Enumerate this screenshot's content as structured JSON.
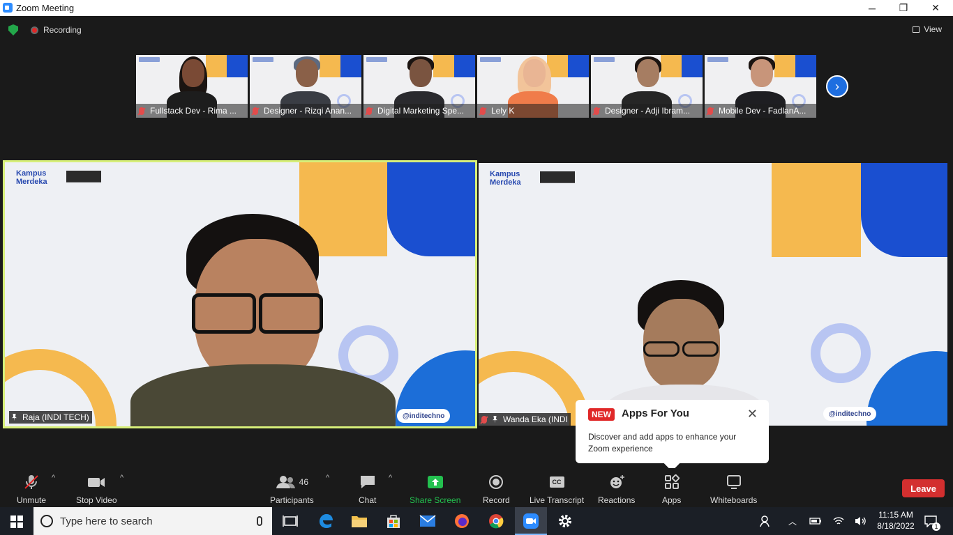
{
  "window": {
    "title": "Zoom Meeting",
    "minimize": "─",
    "restore": "❐",
    "close": "✕"
  },
  "topbar": {
    "recording_label": "Recording",
    "view_label": "View"
  },
  "thumbnails": [
    {
      "name": "Fullstack Dev - Rima ...",
      "skin": "#7a4a35"
    },
    {
      "name": "Designer - Rizqi Anan...",
      "skin": "#8a6048"
    },
    {
      "name": "Digital Marketing Spe...",
      "skin": "#7a5440"
    },
    {
      "name": "Lely K",
      "skin": "#e9b594"
    },
    {
      "name": "Designer - Adji Ibram...",
      "skin": "#a67d62"
    },
    {
      "name": "Mobile Dev - FadlanA...",
      "skin": "#c8957a"
    }
  ],
  "next_page_icon": "chevron-right-icon",
  "main_videos": {
    "left": {
      "name": "Raja (INDI TECH)",
      "handle": "@inditechno",
      "logo_kampus": "Kampus Merdeka",
      "active_speaker": true
    },
    "right": {
      "name": "Wanda Eka (INDI",
      "handle": "@inditechno",
      "logo_kampus": "Kampus Merdeka"
    }
  },
  "popup": {
    "badge": "NEW",
    "title": "Apps For You",
    "text": "Discover and add apps to enhance your Zoom experience",
    "close": "✕"
  },
  "toolbar": {
    "unmute": "Unmute",
    "stop_video": "Stop Video",
    "participants": "Participants",
    "participants_count": "46",
    "chat": "Chat",
    "share_screen": "Share Screen",
    "record": "Record",
    "live_transcript": "Live Transcript",
    "reactions": "Reactions",
    "apps": "Apps",
    "whiteboards": "Whiteboards",
    "leave": "Leave",
    "caret": "^",
    "cc": "CC"
  },
  "taskbar": {
    "search_placeholder": "Type here to search",
    "time": "11:15 AM",
    "date": "8/18/2022",
    "notification_count": "1"
  },
  "colors": {
    "share_green": "#23c04f",
    "leave_red": "#d32f2f",
    "active_border": "#d7ef7a"
  }
}
